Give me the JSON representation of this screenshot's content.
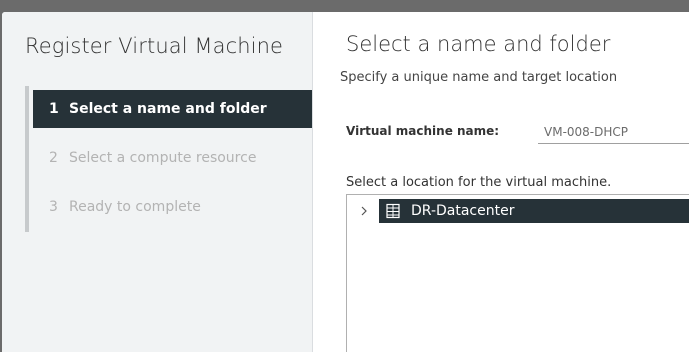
{
  "wizard": {
    "title": "Register Virtual Machine",
    "steps": [
      {
        "number": "1",
        "label": "Select a name and folder",
        "active": true
      },
      {
        "number": "2",
        "label": "Select a compute resource",
        "active": false
      },
      {
        "number": "3",
        "label": "Ready to complete",
        "active": false
      }
    ]
  },
  "page": {
    "title": "Select a name and folder",
    "subtitle": "Specify a unique name and target location",
    "vm_name_label": "Virtual machine name:",
    "vm_name_value": "VM-008-DHCP",
    "location_label": "Select a location for the virtual machine.",
    "tree": [
      {
        "label": "DR-Datacenter",
        "icon": "datacenter-icon",
        "expanded": false,
        "selected": true
      }
    ]
  },
  "colors": {
    "selected_bg": "#263238",
    "sidebar_bg": "#f1f3f4",
    "backdrop": "#6b6b6b"
  }
}
